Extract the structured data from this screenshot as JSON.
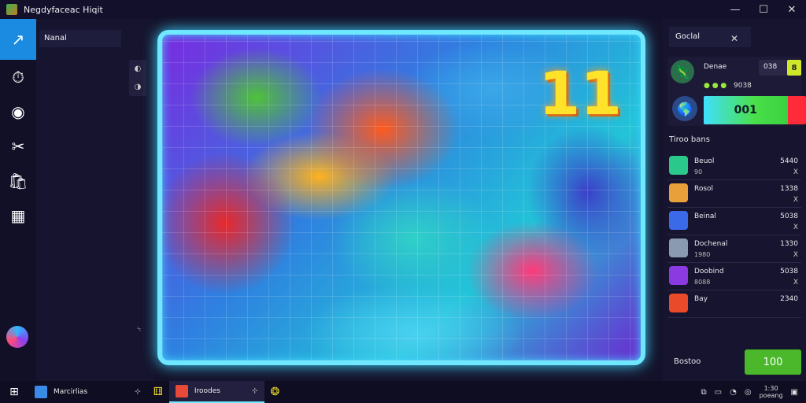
{
  "window": {
    "title": "Negdyfaceac Hiqit",
    "minimize": "—",
    "maximize": "☐",
    "close": "✕"
  },
  "leftbar": {
    "icons": [
      "↗",
      "⏱",
      "◉",
      "✂",
      "🛍",
      "▦"
    ]
  },
  "subpanel": {
    "header": "Nanal",
    "zoom_in": "◐",
    "zoom_out": "◑",
    "cursor": "⍀"
  },
  "board": {
    "number": "11"
  },
  "rightpanel": {
    "header": "Goclal",
    "close": "✕",
    "player": {
      "name": "Denae",
      "score": "038",
      "badge": "8",
      "dots_text": "9038",
      "progress_value": 0.82,
      "progress_label": "001"
    },
    "pieces_title": "Tiroo bans",
    "pieces": [
      {
        "name": "Beuol",
        "sub": "90",
        "count": "5440",
        "x": "X",
        "color": "#2ac88a"
      },
      {
        "name": "Rosol",
        "sub": "",
        "count": "1338",
        "x": "X",
        "color": "#e8a03a"
      },
      {
        "name": "Beinal",
        "sub": "",
        "count": "5038",
        "x": "X",
        "color": "#3a6ae8"
      },
      {
        "name": "Dochenal",
        "sub": "1980",
        "count": "1330",
        "x": "X",
        "color": "#8a9ab0"
      },
      {
        "name": "Doobind",
        "sub": "8088",
        "count": "5038",
        "x": "X",
        "color": "#8a3ae0"
      },
      {
        "name": "Bay",
        "sub": "",
        "count": "2340",
        "x": "",
        "color": "#e84a2a"
      }
    ],
    "footer_label": "Bostoo",
    "footer_button": "100"
  },
  "taskbar": {
    "start": "⊞",
    "apps": [
      {
        "label": "Marcirlias",
        "color": "#3a8ae8"
      },
      {
        "label": "Iroodes",
        "color": "#e84a3a"
      }
    ],
    "pin1": "⊹",
    "pin2": "⚅",
    "pin3": "❂",
    "clock": "1:30\npoeang"
  }
}
